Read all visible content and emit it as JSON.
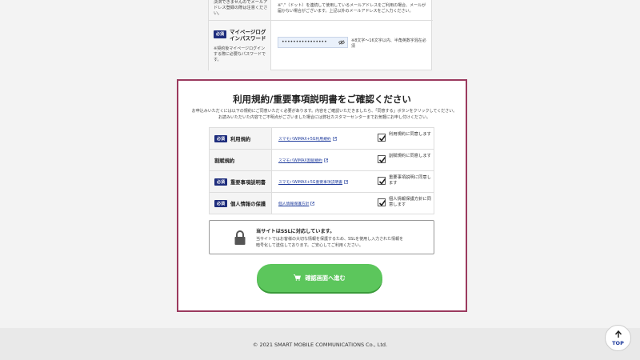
{
  "form_top": {
    "email_note_left": "決済できませんのでメールアドレス登録の際は注意ください。",
    "email_note_right": "※\".\"（ドット）を連続して使用しているメールアドレスをご利用の場合、メールが届かない場合がございます。上記以外のメールアドレスをご入力ください。",
    "required_badge": "必須",
    "password_label": "マイページログインパスワード",
    "password_note_left": "※契約後マイページログインする際に必要なパスワードです。",
    "password_value": "••••••••••••••••",
    "password_note_right": "※8文字〜16文字以内、半角英数字混在必須"
  },
  "panel": {
    "title": "利用規約/重要事項説明書をご確認ください",
    "description_line1": "お申込みいただくには以下の規約にご同意いただく必要があります。内容をご確認いただきましたら、「同意する」ボタンをクリックしてください。",
    "description_line2": "お読みいただいた内容でご不明点がございました場合には弊社カスタマーセンターまでお気軽にお申し付けください。",
    "terms": [
      {
        "required": "必須",
        "label": "利用規約",
        "link": "スマモバWiMAX+5G利用規約",
        "agree": "利用規約に同意します"
      },
      {
        "required": "",
        "label": "割賦規約",
        "link": "スマモバWiMAX割賦規約",
        "agree": "割賦規約に同意します"
      },
      {
        "required": "必須",
        "label": "重要事項説明書",
        "link": "スマモバWiMAX+5G重要事項説明書",
        "agree": "重要事項説明に同意します"
      },
      {
        "required": "必須",
        "label": "個人情報の保護",
        "link": "個人情報保護方針",
        "agree": "個人情報保護方針に同意します"
      }
    ],
    "ssl_title": "当サイトはSSLに対応しています。",
    "ssl_desc_line1": "当サイトではお客様の大切な情報を保護するため、SSLを使用し入力された情報を",
    "ssl_desc_line2": "暗号化して送信しております。ご安心してご利用ください。",
    "confirm_button": "確認画面へ進む"
  },
  "footer": {
    "copyright": "© 2021 SMART MOBILE COMMUNICATIONS Co., Ltd."
  },
  "top_button": {
    "label": "TOP"
  },
  "icons": {
    "eye": "eye-icon",
    "external": "external-link-icon",
    "check": "checkmark-icon",
    "lock": "lock-icon",
    "cart": "cart-icon",
    "arrow_up": "arrow-up-icon"
  },
  "colors": {
    "accent_border": "#9b3a5e",
    "required_badge": "#1e2d7d",
    "link": "#1d3a9c",
    "confirm_button": "#5cc65c"
  }
}
